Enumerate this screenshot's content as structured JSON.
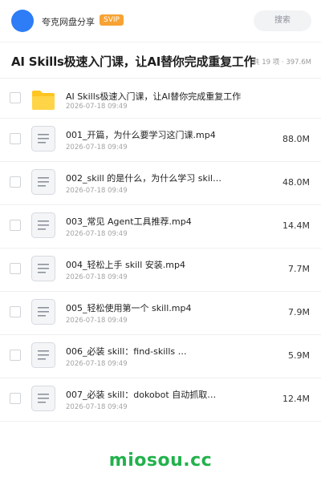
{
  "header": {
    "sharer": "夸克网盘分享",
    "badge": "SVIP",
    "search_label": "搜索"
  },
  "folder": {
    "title": "AI Skills极速入门课，让AI替你完成重复工作",
    "meta": "共 19 项 · 397.6M"
  },
  "files": [
    {
      "type": "folder",
      "name": "AI Skills极速入门课，让AI替你完成重复工作",
      "date": "2026-07-18 09:49",
      "size": ""
    },
    {
      "type": "video",
      "name": "001_开篇，为什么要学习这门课.mp4",
      "date": "2026-07-18 09:49",
      "size": "88.0M"
    },
    {
      "type": "video",
      "name": "002_skill 的是什么，为什么学习 skil…",
      "date": "2026-07-18 09:49",
      "size": "48.0M"
    },
    {
      "type": "video",
      "name": "003_常见 Agent工具推荐.mp4",
      "date": "2026-07-18 09:49",
      "size": "14.4M"
    },
    {
      "type": "video",
      "name": "004_轻松上手 skill 安装.mp4",
      "date": "2026-07-18 09:49",
      "size": "7.7M"
    },
    {
      "type": "video",
      "name": "005_轻松使用第一个 skill.mp4",
      "date": "2026-07-18 09:49",
      "size": "7.9M"
    },
    {
      "type": "video",
      "name": "006_必装 skill：find-skills …",
      "date": "2026-07-18 09:49",
      "size": "5.9M"
    },
    {
      "type": "video",
      "name": "007_必装 skill：dokobot 自动抓取…",
      "date": "2026-07-18 09:49",
      "size": "12.4M"
    }
  ],
  "watermark": "miosou.cc",
  "colors": {
    "accent": "#2e7cf6",
    "svip": "#f7a334",
    "folder": "#ffc520",
    "watermark": "#22b14c"
  },
  "icons": {
    "folder": "folder-icon",
    "video": "file-doc-icon"
  }
}
